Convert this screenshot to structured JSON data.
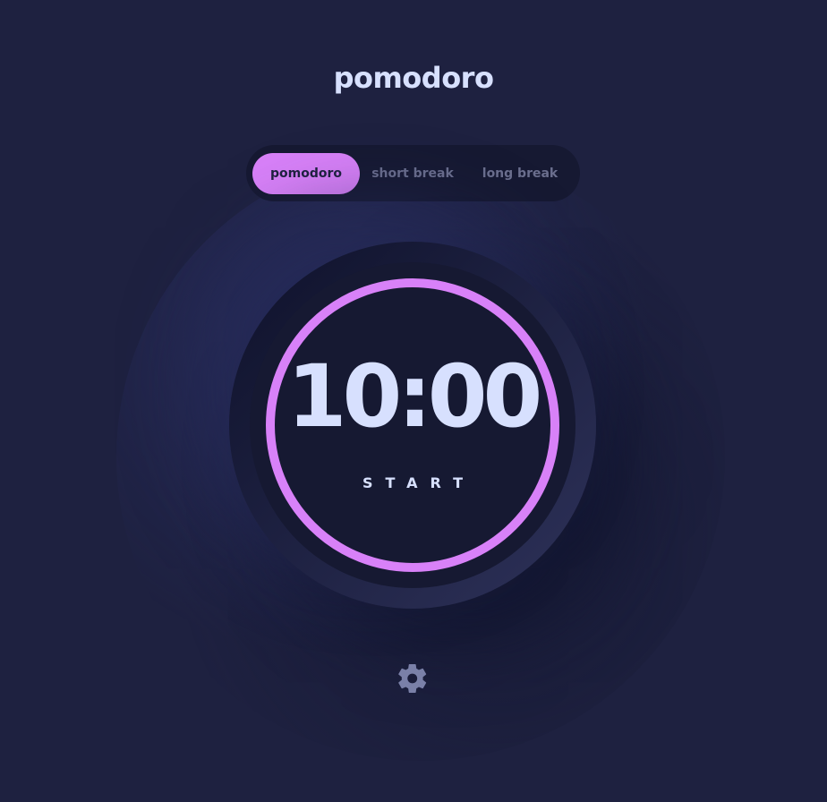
{
  "app": {
    "title": "pomodoro"
  },
  "modes": [
    {
      "label": "pomodoro",
      "active": true
    },
    {
      "label": "short break",
      "active": false
    },
    {
      "label": "long break",
      "active": false
    }
  ],
  "timer": {
    "time": "10:00",
    "action_label": "START",
    "progress": 1.0
  },
  "settings": {
    "icon": "gear-icon"
  },
  "colors": {
    "background": "#1e2140",
    "accent": "#d881f8",
    "text": "#d7e0fe",
    "dark": "#161932",
    "muted": "#6b6f8e"
  }
}
